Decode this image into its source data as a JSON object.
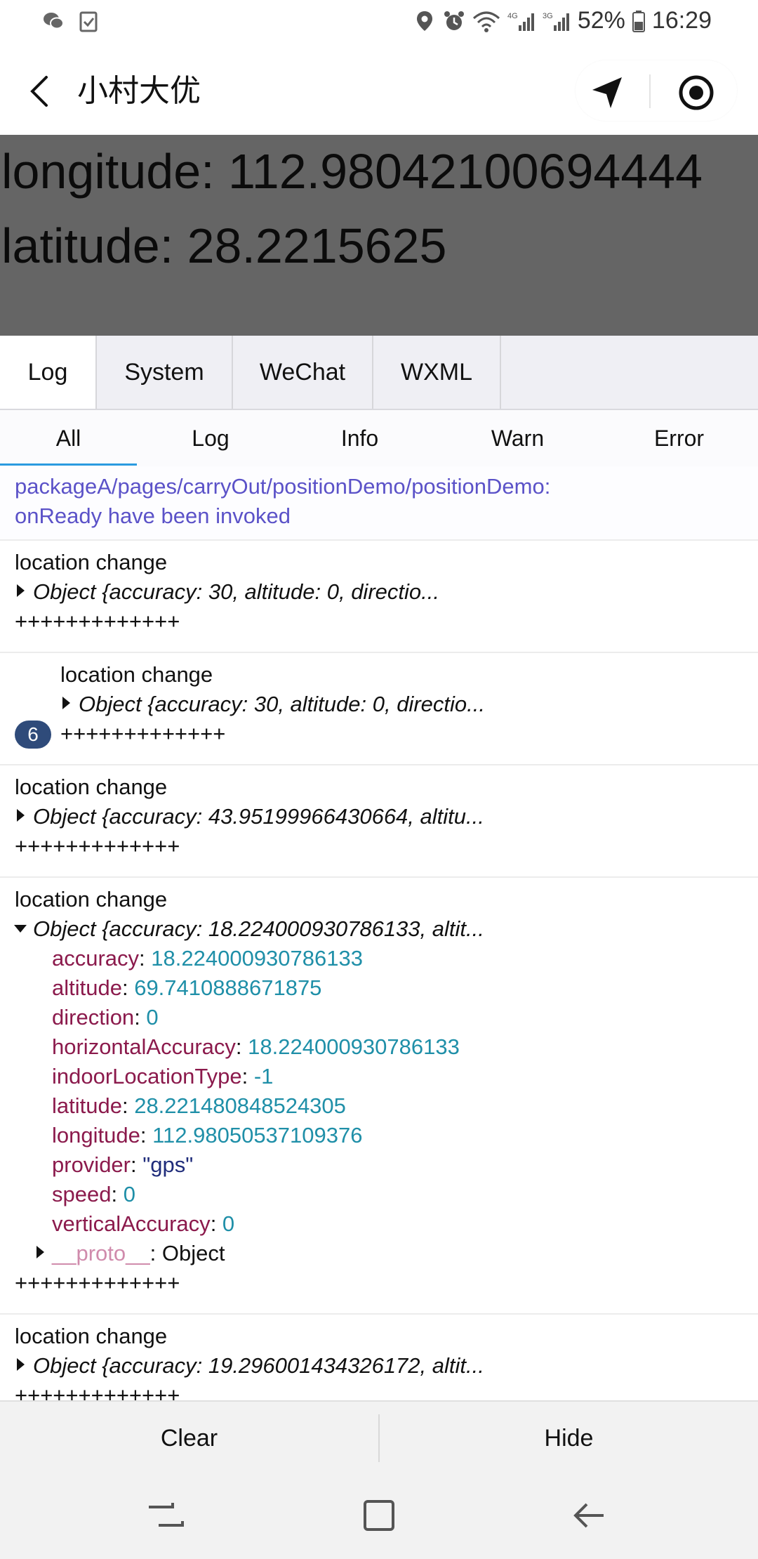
{
  "status_bar": {
    "battery": "52%",
    "time": "16:29",
    "left_icons": [
      "wechat-icon",
      "clipboard-check-icon"
    ],
    "right_icons": [
      "location-pin-icon",
      "alarm-icon",
      "wifi-icon",
      "signal-4g-icon",
      "signal-3g-icon",
      "battery-icon"
    ]
  },
  "navbar": {
    "title": "小村大优",
    "icons": [
      "back-arrow-icon",
      "location-arrow-icon",
      "record-icon"
    ]
  },
  "coords": {
    "longitude": "longitude: 112.98042100694444",
    "latitude": "latitude: 28.2215625"
  },
  "tabs": [
    "Log",
    "System",
    "WeChat",
    "WXML"
  ],
  "active_tab": "Log",
  "subtabs": [
    "All",
    "Log",
    "Info",
    "Warn",
    "Error"
  ],
  "active_subtab": "All",
  "log": {
    "info_line1": "packageA/pages/carryOut/positionDemo/positionDemo:",
    "info_line2": "onReady have been invoked",
    "entry1": {
      "title": "location change",
      "object": "Object {accuracy: 30, altitude: 0, directio...",
      "sep": "+++++++++++++"
    },
    "entry2": {
      "title": "location change",
      "object": "Object {accuracy: 30, altitude: 0, directio...",
      "sep": "+++++++++++++",
      "repeat_count": "6"
    },
    "entry3": {
      "title": "location change",
      "object": "Object {accuracy: 43.95199966430664, altitu...",
      "sep": "+++++++++++++"
    },
    "entry4": {
      "title": "location change",
      "object": "Object {accuracy: 18.224000930786133, altit...",
      "fields": {
        "accuracy_key": "accuracy",
        "accuracy_val": "18.224000930786133",
        "altitude_key": "altitude",
        "altitude_val": "69.7410888671875",
        "direction_key": "direction",
        "direction_val": "0",
        "horizontalAccuracy_key": "horizontalAccuracy",
        "horizontalAccuracy_val": "18.224000930786133",
        "indoorLocationType_key": "indoorLocationType",
        "indoorLocationType_val": "-1",
        "latitude_key": "latitude",
        "latitude_val": "28.221480848524305",
        "longitude_key": "longitude",
        "longitude_val": "112.98050537109376",
        "provider_key": "provider",
        "provider_val": "\"gps\"",
        "speed_key": "speed",
        "speed_val": "0",
        "verticalAccuracy_key": "verticalAccuracy",
        "verticalAccuracy_val": "0",
        "proto_key": "__proto__",
        "proto_val": "Object"
      },
      "sep": "+++++++++++++"
    },
    "entry5": {
      "title": "location change",
      "object": "Object {accuracy: 19.296001434326172, altit...",
      "sep": "+++++++++++++"
    }
  },
  "actions": {
    "clear": "Clear",
    "hide": "Hide"
  },
  "system_nav": [
    "recents-icon",
    "home-icon",
    "back-icon"
  ]
}
